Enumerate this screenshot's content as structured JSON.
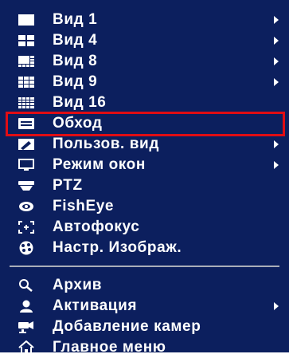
{
  "menu": {
    "items": [
      {
        "label": "Вид 1",
        "icon": "single-view-icon",
        "submenu": true
      },
      {
        "label": "Вид 4",
        "icon": "quad-view-icon",
        "submenu": true
      },
      {
        "label": "Вид 8",
        "icon": "eight-view-icon",
        "submenu": true
      },
      {
        "label": "Вид 9",
        "icon": "nine-view-icon",
        "submenu": true
      },
      {
        "label": "Вид 16",
        "icon": "sixteen-view-icon",
        "submenu": false
      },
      {
        "label": "Обход",
        "icon": "tour-icon",
        "submenu": false,
        "selected": true
      },
      {
        "label": "Пользов. вид",
        "icon": "custom-view-icon",
        "submenu": true
      },
      {
        "label": "Режим окон",
        "icon": "window-mode-icon",
        "submenu": true
      },
      {
        "label": "PTZ",
        "icon": "ptz-icon",
        "submenu": false
      },
      {
        "label": "FishEye",
        "icon": "fisheye-icon",
        "submenu": false
      },
      {
        "label": "Автофокус",
        "icon": "autofocus-icon",
        "submenu": false
      },
      {
        "label": "Настр. Изображ.",
        "icon": "image-settings-icon",
        "submenu": false
      }
    ],
    "items2": [
      {
        "label": "Архив",
        "icon": "search-icon",
        "submenu": false
      },
      {
        "label": "Активация",
        "icon": "activation-icon",
        "submenu": true
      },
      {
        "label": "Добавление камер",
        "icon": "add-camera-icon",
        "submenu": false
      },
      {
        "label": "Главное меню",
        "icon": "home-icon",
        "submenu": false
      }
    ],
    "highlight_color": "#e00d14",
    "background_color": "#0c1f5e"
  }
}
